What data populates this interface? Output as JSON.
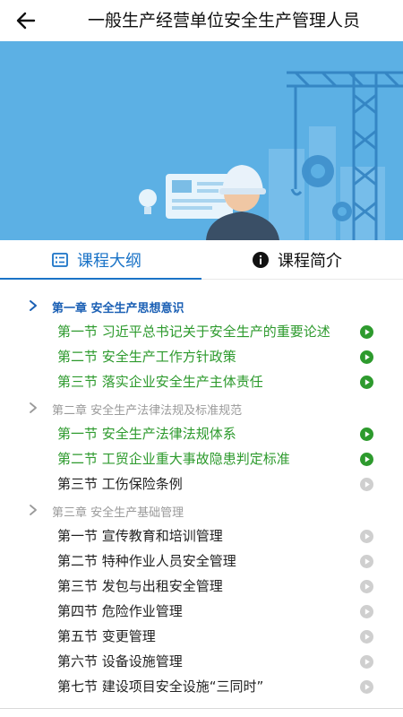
{
  "header": {
    "title": "一般生产经营单位安全生产管理人员",
    "back_icon": "arrow-left-icon"
  },
  "banner": {
    "background": "#5cb0e4",
    "illustration": "construction-crane-worker-illustration"
  },
  "tabs": [
    {
      "label": "课程大纲",
      "icon": "list-icon",
      "selected": true
    },
    {
      "label": "课程简介",
      "icon": "info-icon",
      "selected": false
    }
  ],
  "colors": {
    "accent": "#1a73c7",
    "completed": "#2d9a2d",
    "muted": "#9a9a9a",
    "play_done": "#2d9a2d",
    "play_todo": "#cfcfcf"
  },
  "chapters": [
    {
      "title": "第一章  安全生产思想意识",
      "state": "active",
      "sections": [
        {
          "title": "第一节  习近平总书记关于安全生产的重要论述",
          "completed": true
        },
        {
          "title": "第二节  安全生产工作方针政策",
          "completed": true
        },
        {
          "title": "第三节  落实企业安全生产主体责任",
          "completed": true
        }
      ]
    },
    {
      "title": "第二章  安全生产法律法规及标准规范",
      "state": "muted",
      "sections": [
        {
          "title": "第一节  安全生产法律法规体系",
          "completed": true
        },
        {
          "title": "第二节  工贸企业重大事故隐患判定标准",
          "completed": true
        },
        {
          "title": "第三节  工伤保险条例",
          "completed": false
        }
      ]
    },
    {
      "title": "第三章  安全生产基础管理",
      "state": "muted",
      "sections": [
        {
          "title": "第一节  宣传教育和培训管理",
          "completed": false
        },
        {
          "title": "第二节  特种作业人员安全管理",
          "completed": false
        },
        {
          "title": "第三节  发包与出租安全管理",
          "completed": false
        },
        {
          "title": "第四节  危险作业管理",
          "completed": false
        },
        {
          "title": "第五节  变更管理",
          "completed": false
        },
        {
          "title": "第六节  设备设施管理",
          "completed": false
        },
        {
          "title": "第七节  建设项目安全设施“三同时”",
          "completed": false
        }
      ]
    }
  ]
}
